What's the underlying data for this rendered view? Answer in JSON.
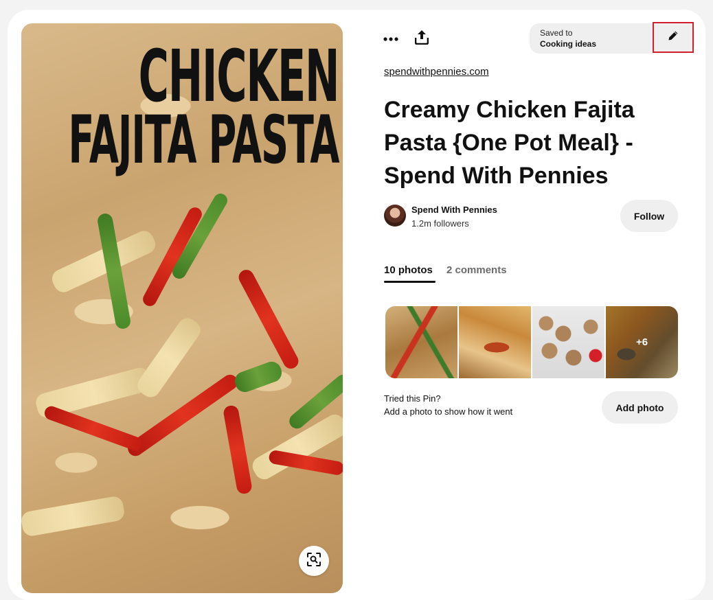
{
  "pin": {
    "image_overlay": {
      "line1": "CHICKEN",
      "line2": "FAJITA PASTA"
    },
    "source_link": "spendwithpennies.com",
    "title": "Creamy Chicken Fajita Pasta {One Pot Meal} - Spend With Pennies"
  },
  "toolbar": {
    "more_icon": "more-horizontal-icon",
    "share_icon": "share-upload-icon",
    "saved_label": "Saved to",
    "saved_board": "Cooking ideas",
    "edit_icon": "pencil-icon",
    "highlight_color": "#d1202b"
  },
  "creator": {
    "name": "Spend With Pennies",
    "followers": "1.2m followers",
    "follow_label": "Follow"
  },
  "tabs": [
    {
      "label": "10 photos",
      "active": true
    },
    {
      "label": "2 comments",
      "active": false
    }
  ],
  "photos": {
    "extra_count_label": "+6"
  },
  "tried": {
    "question": "Tried this Pin?",
    "prompt": "Add a photo to show how it went",
    "button_label": "Add photo"
  },
  "colors": {
    "button_bg": "#efefef",
    "text": "#111111",
    "muted": "#6b6b6b"
  }
}
